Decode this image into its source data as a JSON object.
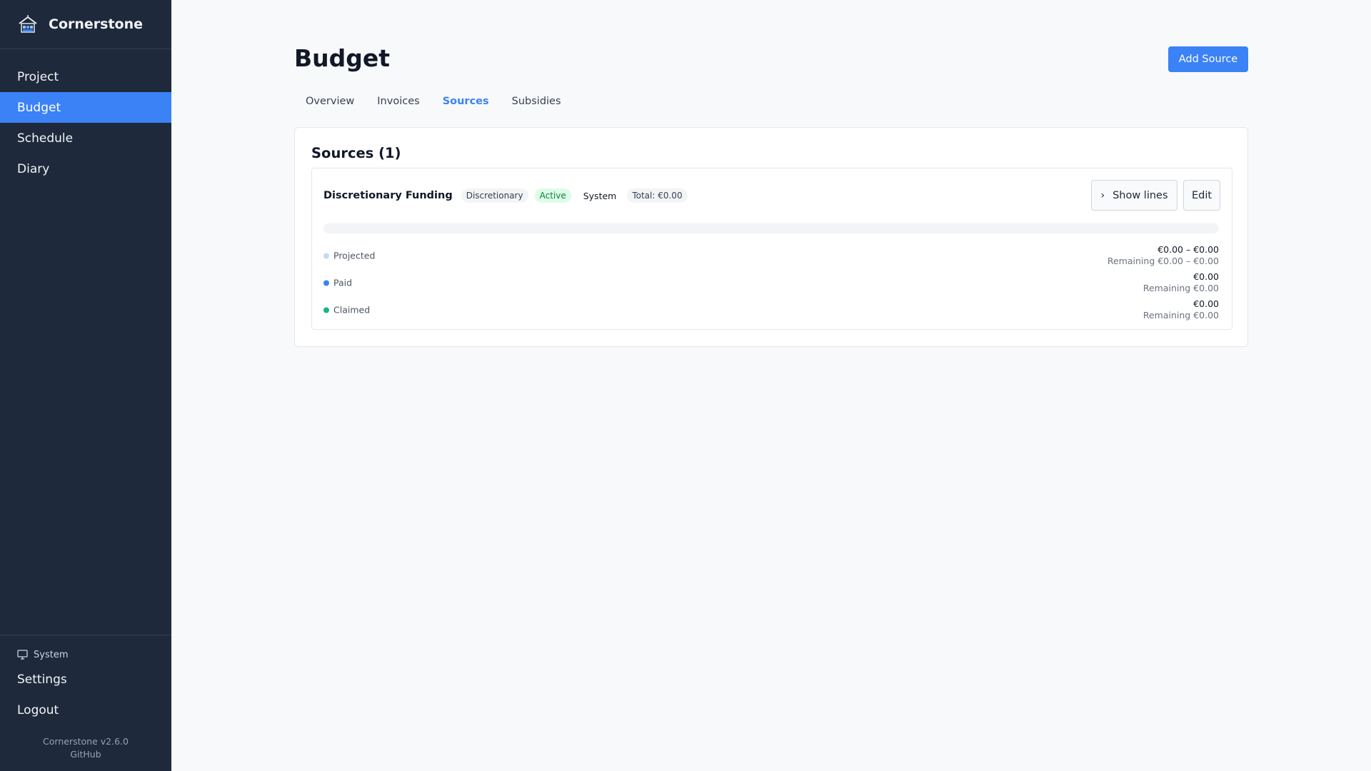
{
  "sidebar": {
    "brand": "Cornerstone",
    "nav": [
      {
        "label": "Project",
        "active": false
      },
      {
        "label": "Budget",
        "active": true
      },
      {
        "label": "Schedule",
        "active": false
      },
      {
        "label": "Diary",
        "active": false
      }
    ],
    "theme_label": "System",
    "settings_label": "Settings",
    "logout_label": "Logout",
    "version": "Cornerstone v2.6.0",
    "github_label": "GitHub"
  },
  "page": {
    "title": "Budget",
    "add_button": "Add Source",
    "tabs": [
      {
        "label": "Overview",
        "active": false
      },
      {
        "label": "Invoices",
        "active": false
      },
      {
        "label": "Sources",
        "active": true
      },
      {
        "label": "Subsidies",
        "active": false
      }
    ]
  },
  "sources": {
    "heading": "Sources (1)",
    "items": [
      {
        "name": "Discretionary Funding",
        "type_badge": "Discretionary",
        "status_badge": "Active",
        "owner": "System",
        "total_badge": "Total: €0.00",
        "show_lines_label": "Show lines",
        "edit_label": "Edit",
        "progress_fraction": 0,
        "metrics": [
          {
            "label": "Projected",
            "amount": "€0.00 – €0.00",
            "remaining": "Remaining €0.00 – €0.00",
            "color": "#bfdbfe"
          },
          {
            "label": "Paid",
            "amount": "€0.00",
            "remaining": "Remaining €0.00",
            "color": "#3b82f6"
          },
          {
            "label": "Claimed",
            "amount": "€0.00",
            "remaining": "Remaining €0.00",
            "color": "#10b981"
          }
        ]
      }
    ]
  },
  "colors": {
    "sidebar_bg": "#1e293b",
    "accent": "#3b82f6",
    "active_badge_bg": "#dcfce7",
    "active_badge_text": "#15803d"
  },
  "icons": {
    "brand": "house-logo-icon",
    "theme": "monitor-icon",
    "show_lines": "chevron-right-icon"
  }
}
